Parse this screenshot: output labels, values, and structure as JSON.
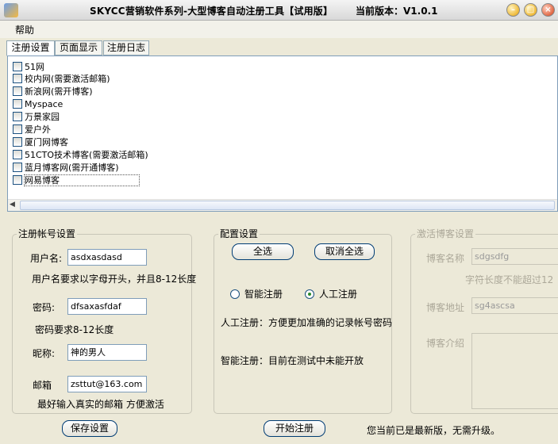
{
  "window": {
    "title": "SKYCC营销软件系列-大型博客自动注册工具【试用版】",
    "version": "当前版本：V1.0.1"
  },
  "menu": {
    "help": "帮助"
  },
  "tabs": [
    "注册设置",
    "页面显示",
    "注册日志"
  ],
  "sites": [
    "51网",
    "校内网(需要激活邮箱)",
    "新浪网(需开博客)",
    "Myspace",
    "万景家园",
    "爱户外",
    "厦门网博客",
    "51CTO技术博客(需要激活邮箱)",
    "蓝月博客网(需开通博客)",
    "网易博客"
  ],
  "account": {
    "title": "注册帐号设置",
    "username_label": "用户名:",
    "username_value": "asdxasdasd",
    "username_hint": "用户名要求以字母开头，并且8-12长度",
    "password_label": "密码:",
    "password_value": "dfsaxasfdaf",
    "password_hint": "密码要求8-12长度",
    "nickname_label": "昵称:",
    "nickname_value": "神的男人",
    "email_label": "邮箱",
    "email_value": "zsttut@163.com",
    "email_hint": "最好输入真实的邮箱 方便激活"
  },
  "config": {
    "title": "配置设置",
    "select_all": "全选",
    "deselect_all": "取消全选",
    "smart_label": "智能注册",
    "manual_label": "人工注册",
    "manual_desc": "人工注册：方便更加准确的记录帐号密码",
    "smart_desc": "智能注册：目前在测试中未能开放"
  },
  "activate": {
    "title": "激活博客设置",
    "name_label": "博客名称",
    "name_value": "sdgsdfg",
    "name_hint": "字符长度不能超过12",
    "url_label": "博客地址",
    "url_value": "sg4ascsa",
    "intro_label": "博客介绍"
  },
  "buttons": {
    "save": "保存设置",
    "start": "开始注册"
  },
  "status": "您当前已是最新版，无需升级。"
}
